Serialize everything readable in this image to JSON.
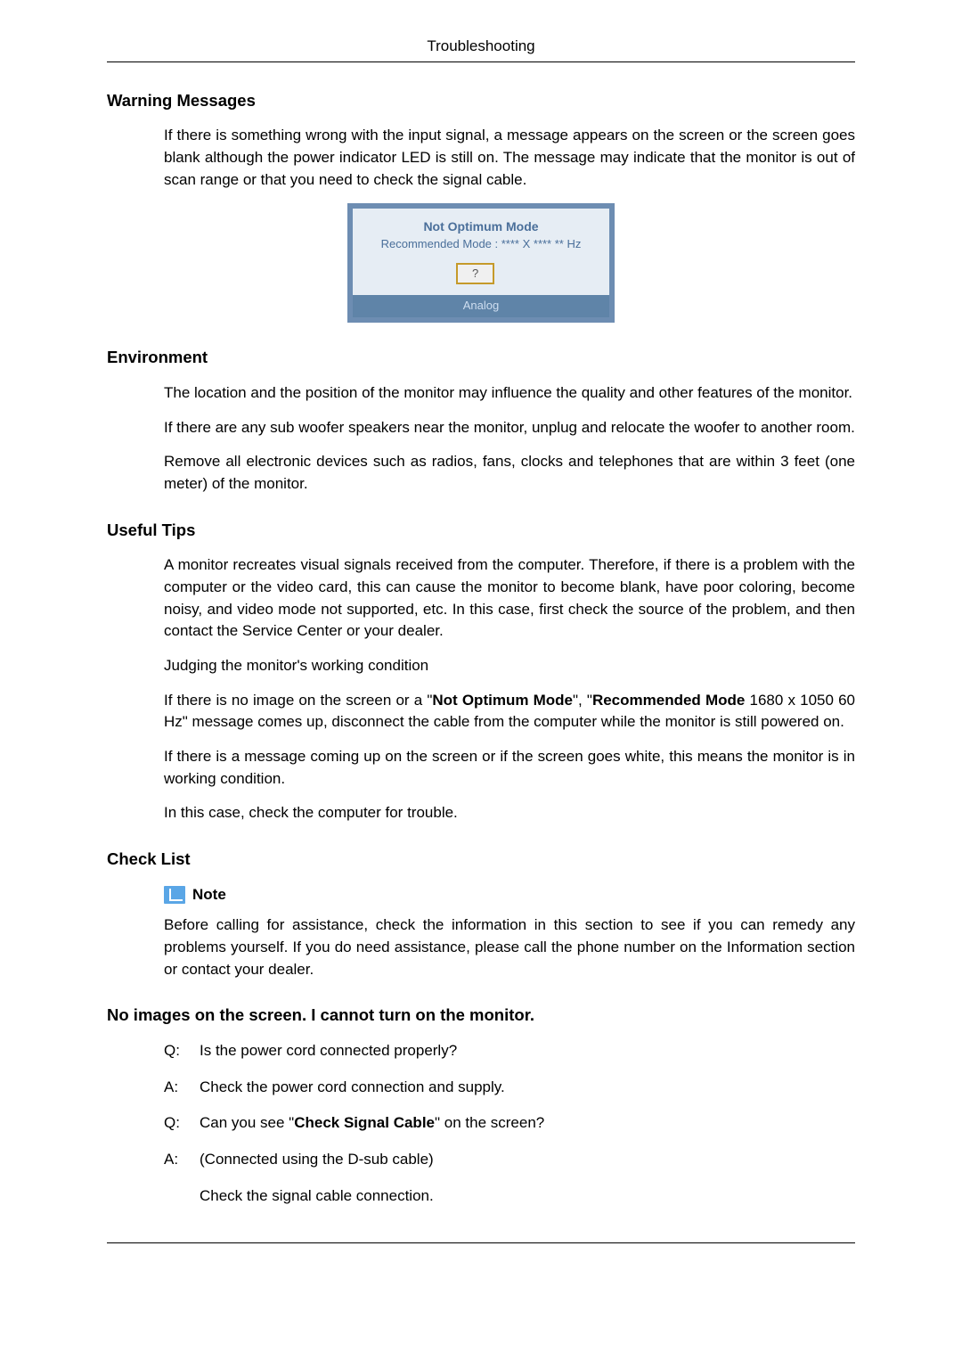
{
  "header": {
    "title": "Troubleshooting"
  },
  "sections": {
    "warning": {
      "heading": "Warning Messages",
      "body": "If there is something wrong with the input signal, a message appears on the screen or the screen goes blank although the power indicator LED is still on. The message may indicate that the monitor is out of scan range or that you need to check the signal cable."
    },
    "osd": {
      "line1": "Not Optimum Mode",
      "line2": "Recommended Mode : **** X **** ** Hz",
      "button": "?",
      "footer": "Analog"
    },
    "environment": {
      "heading": "Environment",
      "p1": "The location and the position of the monitor may influence the quality and other features of the monitor.",
      "p2": "If there are any sub woofer speakers near the monitor, unplug and relocate the woofer to another room.",
      "p3": "Remove all electronic devices such as radios, fans, clocks and telephones that are within 3 feet (one meter) of the monitor."
    },
    "tips": {
      "heading": "Useful Tips",
      "p1": "A monitor recreates visual signals received from the computer. Therefore, if there is a problem with the computer or the video card, this can cause the monitor to become blank, have poor coloring, become noisy, and video mode not supported, etc. In this case, first check the source of the problem, and then contact the Service Center or your dealer.",
      "p2": "Judging the monitor's working condition",
      "p3_pre": "If there is no image on the screen or a \"",
      "p3_b1": "Not Optimum Mode",
      "p3_mid": "\", \"",
      "p3_b2": "Recommended Mode",
      "p3_post": " 1680 x 1050 60 Hz\" message comes up, disconnect the cable from the computer while the monitor is still powered on.",
      "p4": "If there is a message coming up on the screen or if the screen goes white, this means the monitor is in working condition.",
      "p5": "In this case, check the computer for trouble."
    },
    "checklist": {
      "heading": "Check List",
      "note_label": "Note",
      "note_body": "Before calling for assistance, check the information in this section to see if you can remedy any problems yourself. If you do need assistance, please call the phone number on the Information section or contact your dealer."
    },
    "noimages": {
      "heading": "No images on the screen. I cannot turn on the monitor.",
      "qa": [
        {
          "label": "Q:",
          "text": "Is the power cord connected properly?"
        },
        {
          "label": "A:",
          "text": "Check the power cord connection and supply."
        },
        {
          "label": "Q:",
          "pre": "Can you see \"",
          "bold": "Check Signal Cable",
          "post": "\" on the screen?"
        },
        {
          "label": "A:",
          "text": "(Connected using the D-sub cable)"
        }
      ],
      "sub": "Check the signal cable connection."
    }
  }
}
